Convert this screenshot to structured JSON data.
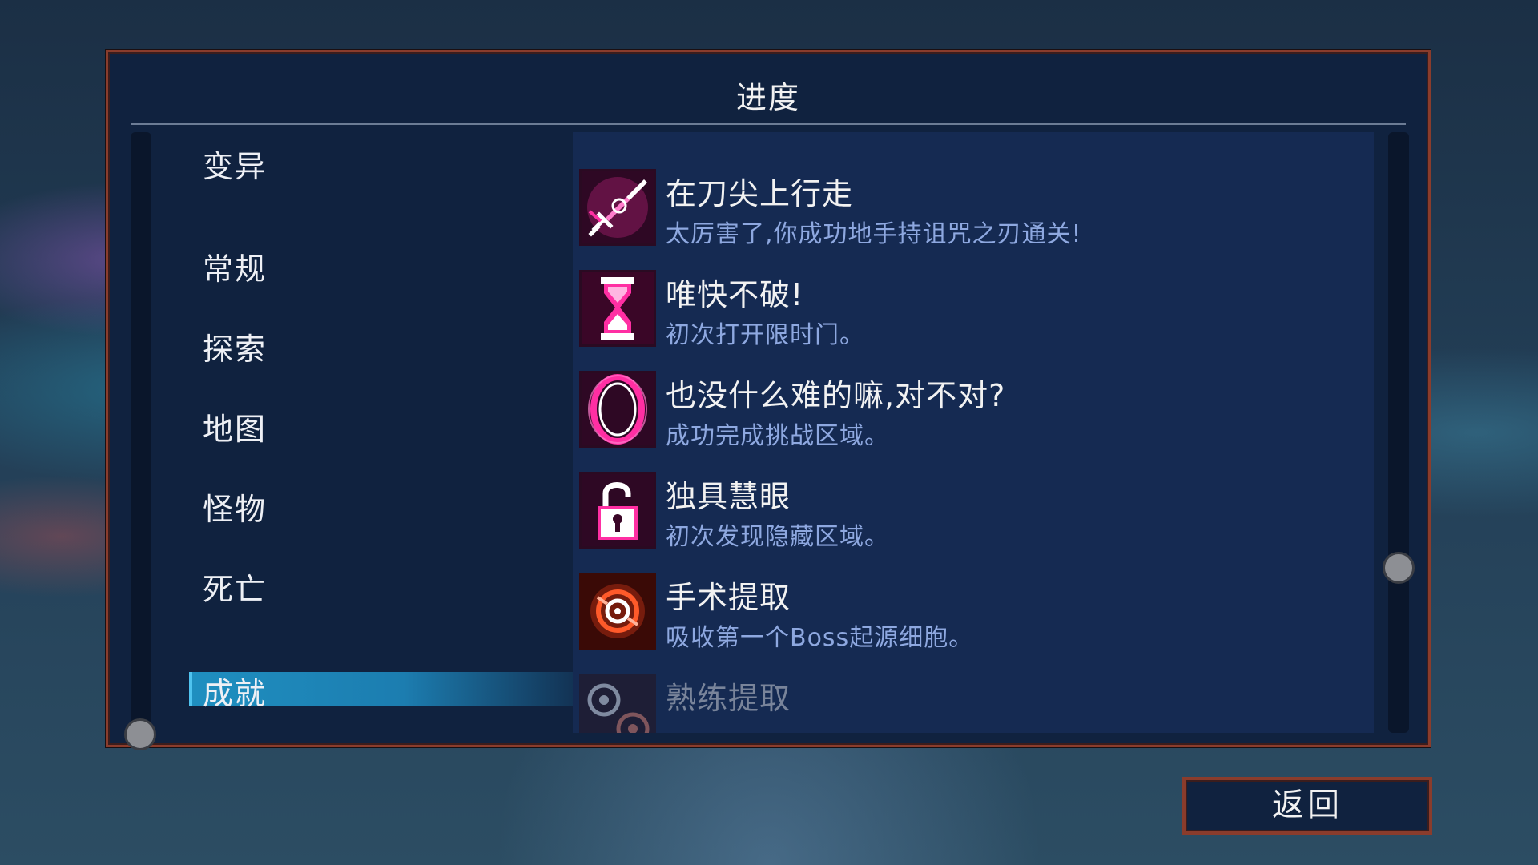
{
  "panel": {
    "title": "进度"
  },
  "categories": [
    {
      "label": "变异"
    },
    {
      "label": "常规"
    },
    {
      "label": "探索"
    },
    {
      "label": "地图"
    },
    {
      "label": "怪物"
    },
    {
      "label": "死亡"
    },
    {
      "label": "成就",
      "selected": true
    }
  ],
  "achievements": [
    {
      "icon": "sword-icon",
      "title": "在刀尖上行走",
      "desc": "太厉害了,你成功地手持诅咒之刃通关!"
    },
    {
      "icon": "hourglass-icon",
      "title": "唯快不破!",
      "desc": "初次打开限时门。"
    },
    {
      "icon": "portal-ring-icon",
      "title": "也没什么难的嘛,对不对?",
      "desc": "成功完成挑战区域。"
    },
    {
      "icon": "unlocked-padlock-icon",
      "title": "独具慧眼",
      "desc": "初次发现隐藏区域。"
    },
    {
      "icon": "cell-extract-icon",
      "title": "手术提取",
      "desc": "吸收第一个Boss起源细胞。"
    },
    {
      "icon": "double-cell-icon",
      "title": "熟练提取",
      "desc": ""
    }
  ],
  "back_button": {
    "label": "返回"
  },
  "colors": {
    "panel_border": "#8a3c2c",
    "selected_category": "#1f8fc0",
    "achievement_desc": "#8ea8e0",
    "icon_magenta": "#ff2fa3",
    "icon_red": "#e8401c"
  }
}
